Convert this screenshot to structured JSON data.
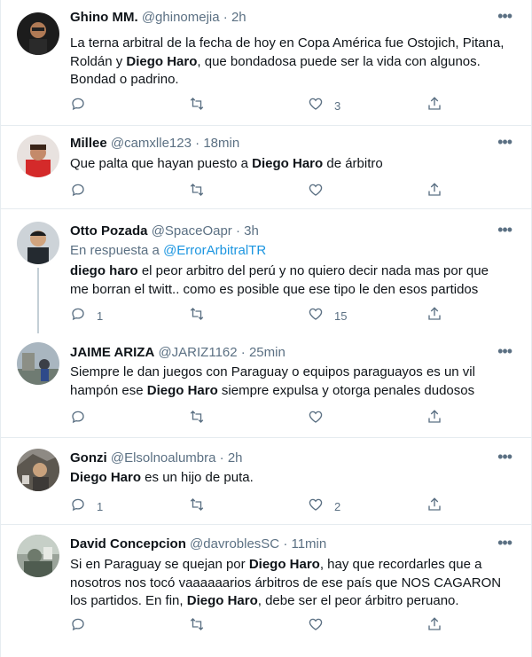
{
  "tweets": [
    {
      "name": "Ghino MM.",
      "handle": "@ghinomejia",
      "dot": "·",
      "time": "2h",
      "body_segments": [
        {
          "text": "La terna arbitral de la fecha de hoy en Copa América fue Ostojich, Pitana, Roldán y ",
          "bold": false
        },
        {
          "text": "Diego Haro",
          "bold": true
        },
        {
          "text": ", que bondadosa puede ser la vida con algunos. Bondad o padrino.",
          "bold": false
        }
      ],
      "replies": "",
      "retweets": "",
      "likes": "3"
    },
    {
      "name": "Millee",
      "handle": "@camxlle123",
      "dot": "·",
      "time": "18min",
      "body_segments": [
        {
          "text": "Que palta que hayan puesto a ",
          "bold": false
        },
        {
          "text": "Diego Haro",
          "bold": true
        },
        {
          "text": " de árbitro",
          "bold": false
        }
      ],
      "replies": "",
      "retweets": "",
      "likes": ""
    },
    {
      "name": "Otto Pozada",
      "handle": "@SpaceOapr",
      "dot": "·",
      "time": "3h",
      "reply_prefix": "En respuesta a",
      "reply_link": "@ErrorArbitralTR",
      "body_segments": [
        {
          "text": "diego haro",
          "bold": true
        },
        {
          "text": " el peor arbitro del perú y no quiero decir nada mas por que me borran el twitt.. como es posible que ese tipo le den esos partidos",
          "bold": false
        }
      ],
      "replies": "1",
      "retweets": "",
      "likes": "15"
    },
    {
      "name": "JAIME ARIZA",
      "handle": "@JARIZ1162",
      "dot": "·",
      "time": "25min",
      "body_segments": [
        {
          "text": "Siempre le dan juegos con Paraguay o equipos paraguayos es un vil hampón ese ",
          "bold": false
        },
        {
          "text": "Diego Haro",
          "bold": true
        },
        {
          "text": " siempre expulsa y otorga penales dudosos",
          "bold": false
        }
      ],
      "replies": "",
      "retweets": "",
      "likes": ""
    },
    {
      "name": "Gonzi",
      "handle": "@Elsolnoalumbra",
      "dot": "·",
      "time": "2h",
      "body_segments": [
        {
          "text": "Diego Haro",
          "bold": true
        },
        {
          "text": " es un hijo de puta.",
          "bold": false
        }
      ],
      "replies": "1",
      "retweets": "",
      "likes": "2"
    },
    {
      "name": "David Concepcion",
      "handle": "@davroblesSC",
      "dot": "·",
      "time": "11min",
      "body_segments": [
        {
          "text": "Si en Paraguay se quejan por ",
          "bold": false
        },
        {
          "text": "Diego Haro",
          "bold": true
        },
        {
          "text": ", hay que recordarles que a nosotros nos tocó vaaaaaarios árbitros de ese país que NOS CAGARON los partidos. En fin, ",
          "bold": false
        },
        {
          "text": "Diego Haro",
          "bold": true
        },
        {
          "text": ", debe ser el peor árbitro peruano.",
          "bold": false
        }
      ],
      "replies": "",
      "retweets": "",
      "likes": ""
    }
  ],
  "more_glyph": "•••",
  "colors": {
    "text": "#0f1419",
    "muted": "#5b7083",
    "link": "#1b95e0",
    "border": "#e6ecf0"
  },
  "icons": [
    "reply-icon",
    "retweet-icon",
    "like-icon",
    "share-icon",
    "more-icon"
  ]
}
